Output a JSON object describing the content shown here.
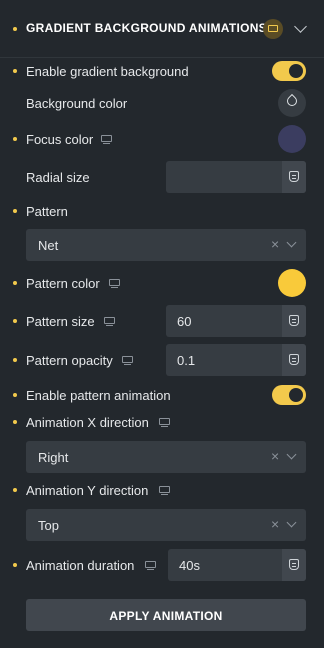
{
  "header": {
    "title": "GRADIENT BACKGROUND ANIMATIONS"
  },
  "fields": {
    "enable_gradient": {
      "label": "Enable gradient background",
      "value": true
    },
    "background_color": {
      "label": "Background color"
    },
    "focus_color": {
      "label": "Focus color",
      "value": "#3b3d60"
    },
    "radial_size": {
      "label": "Radial size",
      "value": ""
    },
    "pattern": {
      "label": "Pattern",
      "value": "Net"
    },
    "pattern_color": {
      "label": "Pattern color",
      "value": "#f9ca3a"
    },
    "pattern_size": {
      "label": "Pattern size",
      "value": "60"
    },
    "pattern_opacity": {
      "label": "Pattern opacity",
      "value": "0.1"
    },
    "enable_pattern_animation": {
      "label": "Enable pattern animation",
      "value": true
    },
    "animation_x_direction": {
      "label": "Animation X direction",
      "value": "Right"
    },
    "animation_y_direction": {
      "label": "Animation Y direction",
      "value": "Top"
    },
    "animation_duration": {
      "label": "Animation duration",
      "value": "40s"
    }
  },
  "apply_button": {
    "label": "APPLY ANIMATION"
  },
  "colors": {
    "accent": "#f2c94c",
    "panel": "#23282d",
    "field": "#363c42"
  }
}
